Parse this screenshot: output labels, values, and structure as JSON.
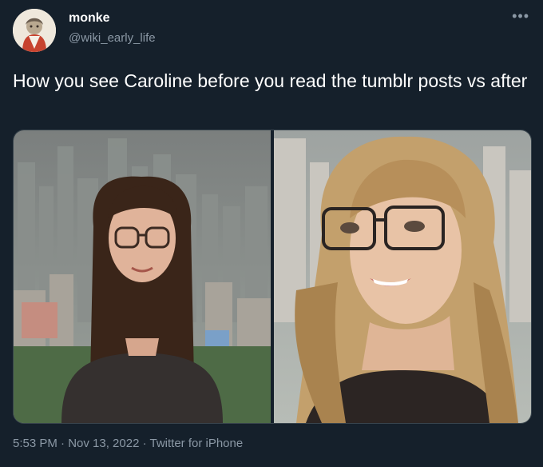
{
  "author": {
    "display_name": "monke",
    "handle": "@wiki_early_life",
    "avatar_icon": "avatar-illustration"
  },
  "more_icon": "•••",
  "tweet": {
    "text": "How you see Caroline before you read the tumblr posts vs after"
  },
  "media": [
    {
      "name": "before-photo",
      "description_icon": "photo"
    },
    {
      "name": "after-photo",
      "description_icon": "photo"
    }
  ],
  "meta": {
    "line": "5:53 PM · Nov 13, 2022 · Twitter for iPhone"
  },
  "colors": {
    "background": "#15202b",
    "text_primary": "#ffffff",
    "text_secondary": "#8b98a5",
    "border": "#38444d"
  }
}
